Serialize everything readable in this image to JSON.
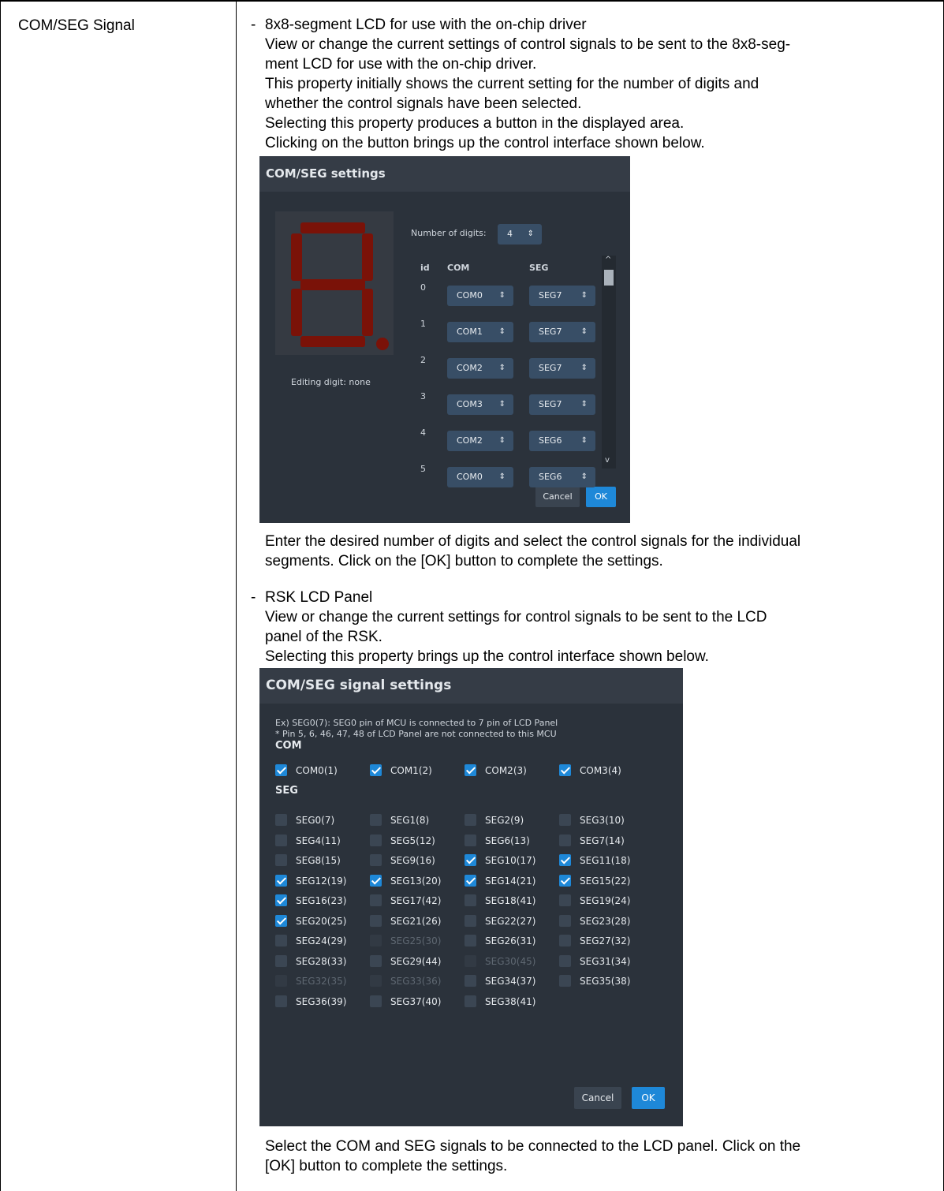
{
  "row": {
    "property": "COM/SEG Signal",
    "section1": {
      "dash": "-",
      "heading": "8x8-segment LCD for use with the on-chip driver",
      "lines": [
        "View or change the current settings of control signals to be sent to the 8x8-seg-",
        "ment LCD for use with the on-chip driver.",
        "This property initially shows the current setting for the number of digits and",
        "whether the control signals have been selected.",
        "Selecting this property produces a button in the displayed area.",
        "Clicking on the button brings up the control interface shown below."
      ],
      "after": [
        "Enter the desired number of digits and select the control signals for the individual",
        "segments. Click on the [OK] button to complete the settings."
      ]
    },
    "section2": {
      "dash": "-",
      "heading": "RSK LCD Panel",
      "lines": [
        "View or change the current settings for control signals to be sent to the LCD",
        "panel of the RSK.",
        "Selecting this property brings up the control interface shown below."
      ],
      "after": [
        "Select the COM and SEG signals to be connected to the LCD panel. Click on the",
        "[OK] button to complete the settings."
      ]
    }
  },
  "dialog1": {
    "title": "COM/SEG settings",
    "editing_label": "Editing digit: none",
    "digits_label": "Number of digits:",
    "digits_value": "4",
    "spin_arrow": "⇕",
    "columns": [
      "id",
      "COM",
      "SEG"
    ],
    "rows": [
      {
        "id": "0",
        "com": "COM0",
        "seg": "SEG7"
      },
      {
        "id": "1",
        "com": "COM1",
        "seg": "SEG7"
      },
      {
        "id": "2",
        "com": "COM2",
        "seg": "SEG7"
      },
      {
        "id": "3",
        "com": "COM3",
        "seg": "SEG7"
      },
      {
        "id": "4",
        "com": "COM2",
        "seg": "SEG6"
      },
      {
        "id": "5",
        "com": "COM0",
        "seg": "SEG6"
      }
    ],
    "scroll_up": "^",
    "scroll_down": "v",
    "cancel": "Cancel",
    "ok": "OK"
  },
  "dialog2": {
    "title": "COM/SEG signal settings",
    "note1": "Ex) SEG0(7): SEG0 pin of MCU is connected to 7 pin of LCD Panel",
    "note2": "* Pin 5, 6, 46, 47, 48 of LCD Panel are not connected to this MCU",
    "com_heading": "COM",
    "seg_heading": "SEG",
    "com": [
      {
        "label": "COM0(1)",
        "checked": true
      },
      {
        "label": "COM1(2)",
        "checked": true
      },
      {
        "label": "COM2(3)",
        "checked": true
      },
      {
        "label": "COM3(4)",
        "checked": true
      }
    ],
    "seg": [
      {
        "label": "SEG0(7)",
        "checked": false
      },
      {
        "label": "SEG1(8)",
        "checked": false
      },
      {
        "label": "SEG2(9)",
        "checked": false
      },
      {
        "label": "SEG3(10)",
        "checked": false
      },
      {
        "label": "SEG4(11)",
        "checked": false
      },
      {
        "label": "SEG5(12)",
        "checked": false
      },
      {
        "label": "SEG6(13)",
        "checked": false
      },
      {
        "label": "SEG7(14)",
        "checked": false
      },
      {
        "label": "SEG8(15)",
        "checked": false
      },
      {
        "label": "SEG9(16)",
        "checked": false
      },
      {
        "label": "SEG10(17)",
        "checked": true
      },
      {
        "label": "SEG11(18)",
        "checked": true
      },
      {
        "label": "SEG12(19)",
        "checked": true
      },
      {
        "label": "SEG13(20)",
        "checked": true
      },
      {
        "label": "SEG14(21)",
        "checked": true
      },
      {
        "label": "SEG15(22)",
        "checked": true
      },
      {
        "label": "SEG16(23)",
        "checked": true
      },
      {
        "label": "SEG17(42)",
        "checked": false
      },
      {
        "label": "SEG18(41)",
        "checked": false
      },
      {
        "label": "SEG19(24)",
        "checked": false
      },
      {
        "label": "SEG20(25)",
        "checked": true
      },
      {
        "label": "SEG21(26)",
        "checked": false
      },
      {
        "label": "SEG22(27)",
        "checked": false
      },
      {
        "label": "SEG23(28)",
        "checked": false
      },
      {
        "label": "SEG24(29)",
        "checked": false
      },
      {
        "label": "SEG25(30)",
        "checked": false,
        "disabled": true
      },
      {
        "label": "SEG26(31)",
        "checked": false
      },
      {
        "label": "SEG27(32)",
        "checked": false
      },
      {
        "label": "SEG28(33)",
        "checked": false
      },
      {
        "label": "SEG29(44)",
        "checked": false
      },
      {
        "label": "SEG30(45)",
        "checked": false,
        "disabled": true
      },
      {
        "label": "SEG31(34)",
        "checked": false
      },
      {
        "label": "SEG32(35)",
        "checked": false,
        "disabled": true
      },
      {
        "label": "SEG33(36)",
        "checked": false,
        "disabled": true
      },
      {
        "label": "SEG34(37)",
        "checked": false
      },
      {
        "label": "SEG35(38)",
        "checked": false
      },
      {
        "label": "SEG36(39)",
        "checked": false
      },
      {
        "label": "SEG37(40)",
        "checked": false
      },
      {
        "label": "SEG38(41)",
        "checked": false
      }
    ],
    "cancel": "Cancel",
    "ok": "OK"
  },
  "colors": {
    "dialog_bg": "#2b323b",
    "segment_red": "#7a1208",
    "accent_blue": "#1e88d8"
  }
}
